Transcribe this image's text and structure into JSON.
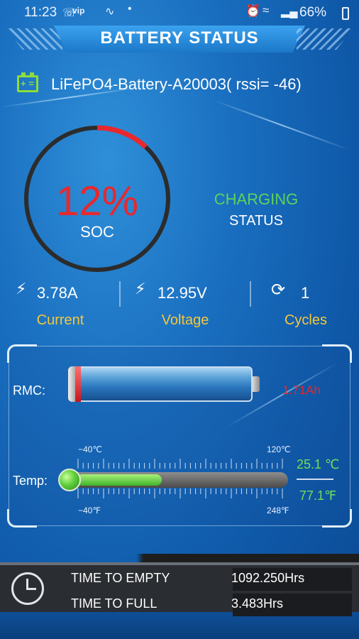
{
  "status_bar": {
    "time": "11:23",
    "carrier": "vip",
    "battery_percent": "66%"
  },
  "header": {
    "title": "BATTERY STATUS"
  },
  "device": {
    "name": "LiFePO4-Battery-A20003( rssi= -46)"
  },
  "soc": {
    "value": "12%",
    "label": "SOC",
    "level": 0.12
  },
  "status": {
    "value": "CHARGING",
    "label": "STATUS"
  },
  "metrics": {
    "current": {
      "value": "3.78A",
      "label": "Current",
      "icon": "bolt-icon"
    },
    "voltage": {
      "value": "12.95V",
      "label": "Voltage",
      "icon": "bolt-icon"
    },
    "cycles": {
      "value": "1",
      "label": "Cycles",
      "icon": "refresh-icon"
    }
  },
  "rmc": {
    "label": "RMC:",
    "value": "1.71Ah",
    "level": 0.12
  },
  "temp": {
    "label": "Temp:",
    "c_min": "−40℃",
    "c_max": "120℃",
    "f_min": "−40℉",
    "f_max": "248℉",
    "celsius": "25.1 ℃",
    "fahrenheit": "77.1℉",
    "level": 0.41
  },
  "times": {
    "to_empty_label": "TIME TO EMPTY",
    "to_empty_value": "1092.250Hrs",
    "to_full_label": "TIME TO FULL",
    "to_full_value": "3.483Hrs"
  },
  "colors": {
    "accent_red": "#e8282d",
    "accent_green": "#5cd35a",
    "accent_yellow": "#f5c73b",
    "background": "#1a6fc0"
  }
}
